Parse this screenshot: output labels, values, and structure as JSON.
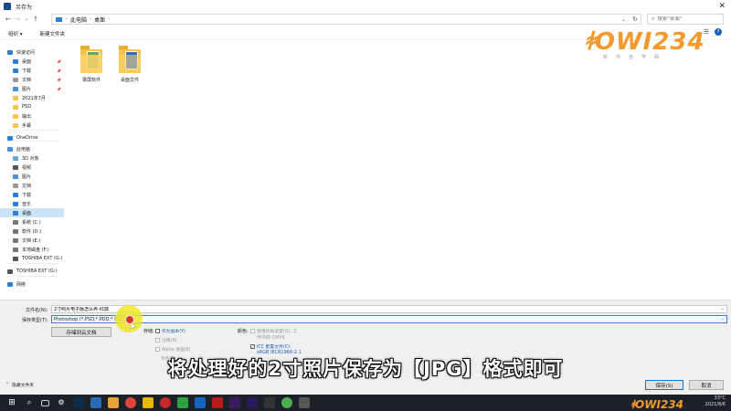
{
  "window": {
    "title": "另存为",
    "close_glyph": "✕"
  },
  "address": {
    "crumbs": [
      "此电脑",
      "桌面"
    ],
    "search_placeholder": "搜索\"桌面\""
  },
  "toolbar": {
    "organize": "组织 ▾",
    "new_folder": "新建文件夹",
    "help": "?"
  },
  "sidebar": {
    "items": [
      {
        "label": "快速访问",
        "icon": "star-icon"
      },
      {
        "label": "桌面",
        "icon": "desktop-icon"
      },
      {
        "label": "下载",
        "icon": "download-icon"
      },
      {
        "label": "文档",
        "icon": "document-icon"
      },
      {
        "label": "图片",
        "icon": "picture-icon"
      },
      {
        "label": "2021年7月",
        "icon": "folder-icon"
      },
      {
        "label": "PSD",
        "icon": "folder-icon"
      },
      {
        "label": "输出",
        "icon": "folder-icon"
      },
      {
        "label": "手幕",
        "icon": "folder-icon"
      },
      {
        "label": "OneDrive",
        "icon": "cloud-icon"
      },
      {
        "label": "此电脑",
        "icon": "computer-icon"
      },
      {
        "label": "3D 对象",
        "icon": "cube-icon"
      },
      {
        "label": "视频",
        "icon": "video-icon"
      },
      {
        "label": "图片",
        "icon": "picture-icon"
      },
      {
        "label": "文档",
        "icon": "document-icon"
      },
      {
        "label": "下载",
        "icon": "download-icon"
      },
      {
        "label": "音乐",
        "icon": "music-icon"
      },
      {
        "label": "桌面",
        "icon": "desktop-icon"
      },
      {
        "label": "系统 (C:)",
        "icon": "drive-icon"
      },
      {
        "label": "软件 (D:)",
        "icon": "drive-icon"
      },
      {
        "label": "文档 (E:)",
        "icon": "drive-icon"
      },
      {
        "label": "本地磁盘 (F:)",
        "icon": "drive-icon"
      },
      {
        "label": "TOSHIBA EXT (G:)",
        "icon": "usb-drive-icon"
      },
      {
        "label": "TOSHIBA EXT (G:)",
        "icon": "usb-drive-icon"
      },
      {
        "label": "网络",
        "icon": "network-icon"
      }
    ]
  },
  "files": [
    {
      "name": "录屏软件"
    },
    {
      "name": "桌面文件"
    }
  ],
  "form": {
    "filename_label": "文件名(N):",
    "filename_value": "2寸照片电子版怎么弄-红底",
    "filetype_label": "保存类型(T):",
    "filetype_value": "Photoshop (*.PSD;*.PDD;*.PSDT)",
    "save_cloud_button": "存储到云文档",
    "storage_label": "存储:",
    "as_copy": "作为副本(Y)",
    "notes": "注释(N)",
    "alpha": "Alpha 通道(E)",
    "spot": "专色(P)",
    "color_label": "颜色:",
    "use_proof": "使用校样设置(O): 工",
    "proof_cmyk": "作中的 CMYK",
    "icc": "ICC 配置文件(C):",
    "icc_value": "sRGB IEC61966-2.1",
    "save_button": "保存(S)",
    "cancel_button": "取消",
    "hide_folders": "隐藏文件夹"
  },
  "subtitle": "将处理好的2寸照片保存为【JPG】格式即可",
  "watermark": {
    "logo": "ꬸOWI234",
    "tagline": "软件自学网"
  },
  "taskbar": {
    "weather": "33°C",
    "date": "2021/8/6"
  }
}
